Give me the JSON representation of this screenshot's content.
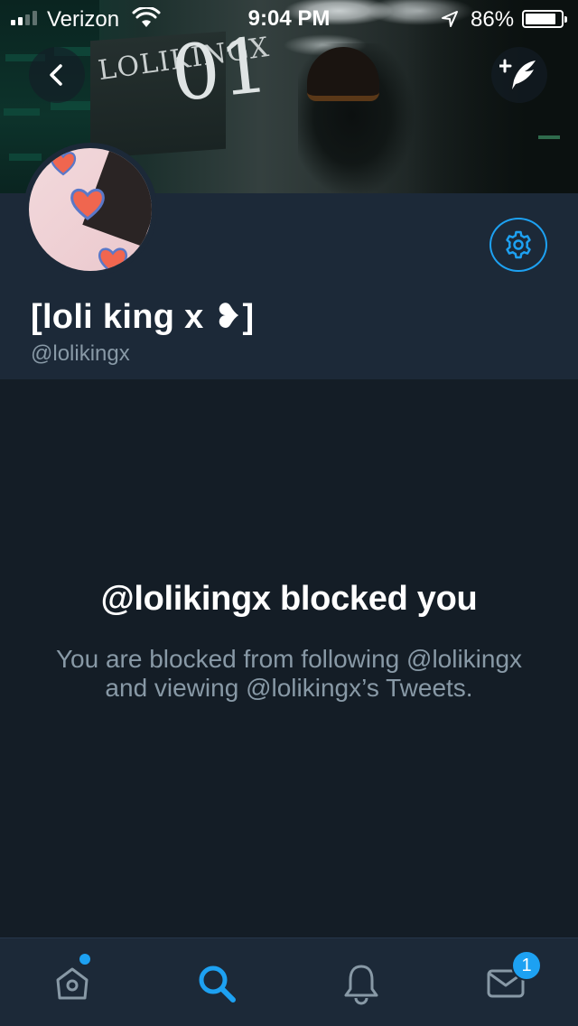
{
  "status_bar": {
    "carrier": "Verizon",
    "time": "9:04 PM",
    "battery_percent_label": "86%",
    "battery_level": 0.86,
    "signal_bars_filled": 2,
    "signal_bars_total": 4
  },
  "header": {
    "banner_sign_text": "LOLIKINGX",
    "banner_sign_number": "01",
    "back_icon": "chevron-left-icon",
    "compose_icon": "compose-tweet-icon"
  },
  "profile": {
    "display_name": "[loli king x ❥]",
    "handle": "@lolikingx",
    "settings_icon": "gear-icon"
  },
  "blocked": {
    "title": "@lolikingx blocked you",
    "body": "You are blocked from following @lolikingx and viewing @lolikingx’s Tweets."
  },
  "tabbar": {
    "tabs": [
      {
        "id": "home",
        "icon": "home-icon",
        "active": false,
        "has_dot": true
      },
      {
        "id": "search",
        "icon": "search-icon",
        "active": true
      },
      {
        "id": "notifications",
        "icon": "bell-icon",
        "active": false
      },
      {
        "id": "messages",
        "icon": "envelope-icon",
        "active": false,
        "badge": "1"
      }
    ]
  },
  "colors": {
    "accent": "#1da1f2",
    "background": "#141d26",
    "surface": "#1c2938",
    "secondary_text": "#8899a6"
  }
}
